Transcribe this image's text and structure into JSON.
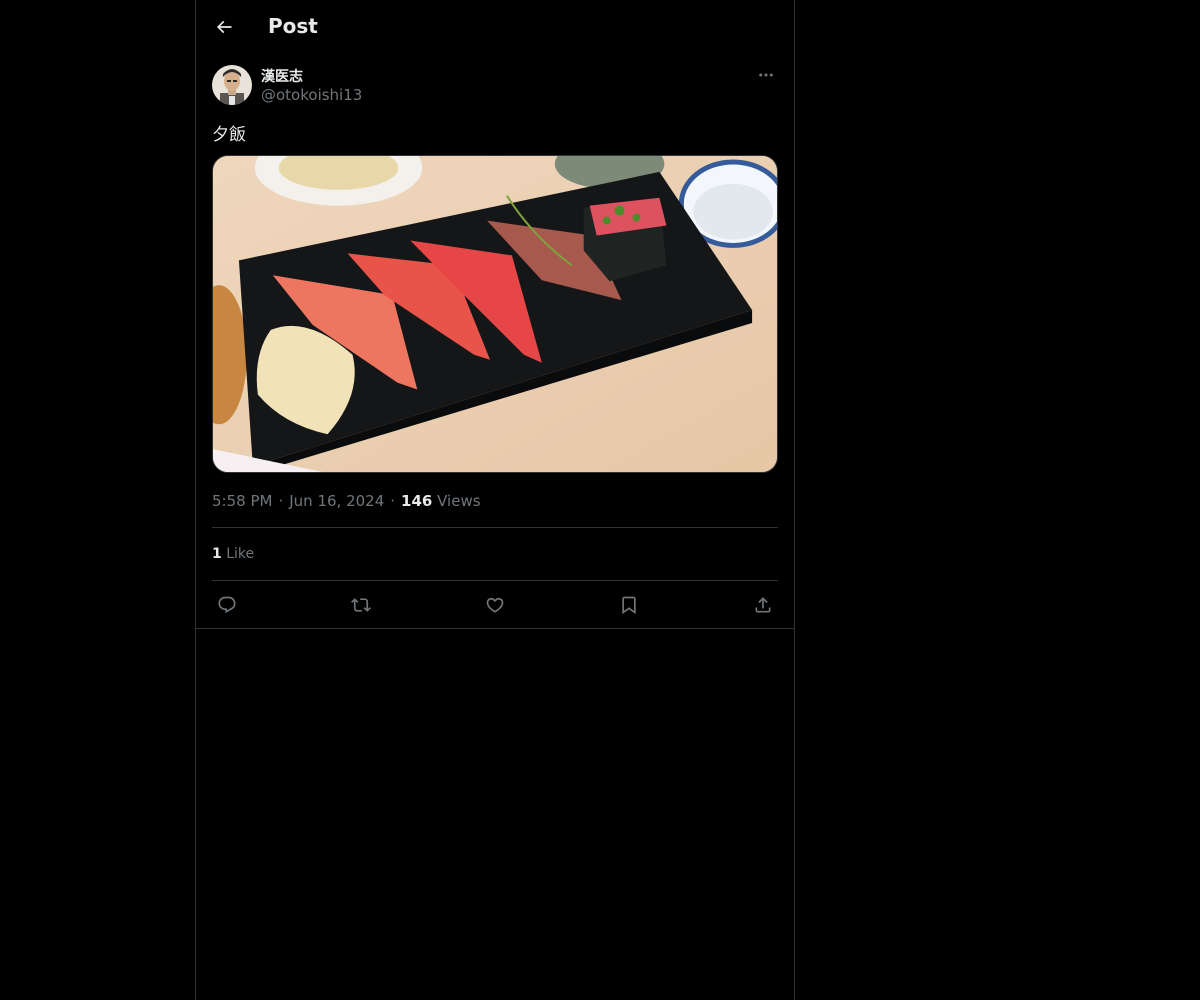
{
  "header": {
    "title": "Post"
  },
  "author": {
    "display_name": "漢医志",
    "handle": "@otokoishi13"
  },
  "post": {
    "text": "夕飯",
    "time": "5:58 PM",
    "separator": "·",
    "date": "Jun 16, 2024",
    "views_count": "146",
    "views_label": "Views",
    "likes_count": "1",
    "likes_label": "Like"
  },
  "icons": {
    "back": "arrow-left-icon",
    "more": "more-dots-icon",
    "reply": "reply-icon",
    "repost": "repost-icon",
    "like": "heart-icon",
    "bookmark": "bookmark-icon",
    "share": "share-icon"
  },
  "colors": {
    "background": "#000000",
    "text": "#e7e9ea",
    "muted": "#71767b",
    "border": "#2f3336"
  }
}
